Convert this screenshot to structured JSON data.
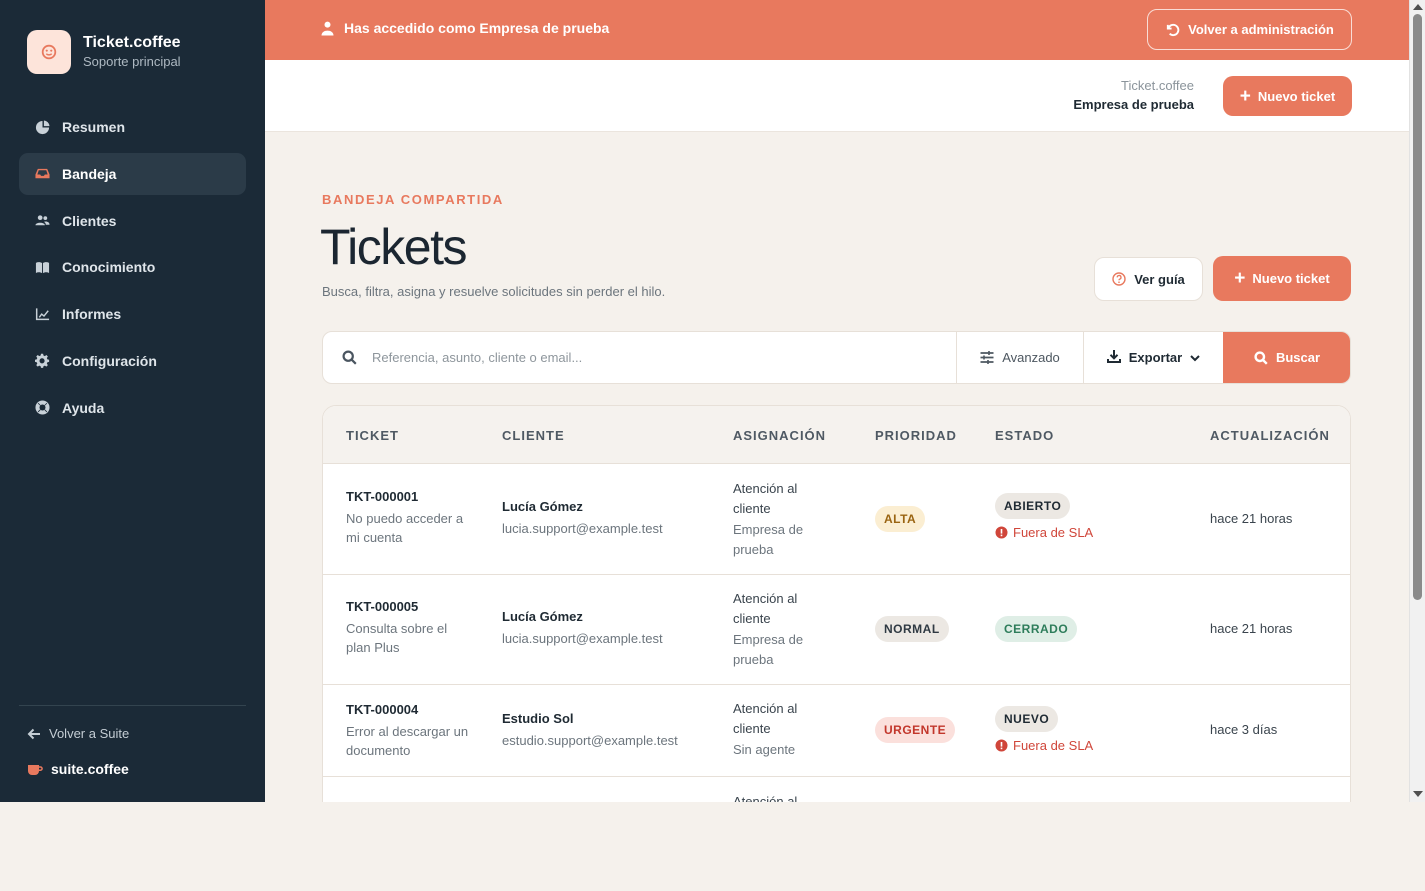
{
  "sidebar": {
    "brand_title": "Ticket.coffee",
    "brand_subtitle": "Soporte principal",
    "items": [
      {
        "label": "Resumen",
        "icon": "pie-chart-icon",
        "active": false
      },
      {
        "label": "Bandeja",
        "icon": "inbox-icon",
        "active": true
      },
      {
        "label": "Clientes",
        "icon": "users-icon",
        "active": false
      },
      {
        "label": "Conocimiento",
        "icon": "book-icon",
        "active": false
      },
      {
        "label": "Informes",
        "icon": "line-chart-icon",
        "active": false
      },
      {
        "label": "Configuración",
        "icon": "gear-icon",
        "active": false
      },
      {
        "label": "Ayuda",
        "icon": "lifebuoy-icon",
        "active": false
      }
    ],
    "back_label": "Volver a Suite",
    "suite_label": "suite.coffee"
  },
  "banner": {
    "message": "Has accedido como Empresa de prueba",
    "button": "Volver a administración"
  },
  "header": {
    "org_line1": "Ticket.coffee",
    "org_line2": "Empresa de prueba",
    "new_ticket": "Nuevo ticket"
  },
  "main": {
    "eyebrow": "BANDEJA COMPARTIDA",
    "title": "Tickets",
    "subtitle": "Busca, filtra, asigna y resuelve solicitudes sin perder el hilo.",
    "guide_button": "Ver guía",
    "new_ticket_button": "Nuevo ticket"
  },
  "search": {
    "placeholder": "Referencia, asunto, cliente o email...",
    "value": "",
    "advanced": "Avanzado",
    "export": "Exportar",
    "submit": "Buscar"
  },
  "table": {
    "headers": [
      "TICKET",
      "CLIENTE",
      "ASIGNACIÓN",
      "PRIORIDAD",
      "ESTADO",
      "ACTUALIZACIÓN"
    ],
    "rows": [
      {
        "id": "TKT-000001",
        "subject": "No puedo acceder a mi cuenta",
        "client_name": "Lucía Gómez",
        "client_email": "lucia.support@example.test",
        "team": "Atención al cliente",
        "agent": "Empresa de prueba",
        "priority": "ALTA",
        "status": "ABIERTO",
        "sla": "Fuera de SLA",
        "updated": "hace 21 horas"
      },
      {
        "id": "TKT-000005",
        "subject": "Consulta sobre el plan Plus",
        "client_name": "Lucía Gómez",
        "client_email": "lucia.support@example.test",
        "team": "Atención al cliente",
        "agent": "Empresa de prueba",
        "priority": "NORMAL",
        "status": "CERRADO",
        "sla": "",
        "updated": "hace 21 horas"
      },
      {
        "id": "TKT-000004",
        "subject": "Error al descargar un documento",
        "client_name": "Estudio Sol",
        "client_email": "estudio.support@example.test",
        "team": "Atención al cliente",
        "agent": "Sin agente",
        "priority": "URGENTE",
        "status": "NUEVO",
        "sla": "Fuera de SLA",
        "updated": "hace 3 días"
      },
      {
        "team": "Atención al"
      }
    ]
  },
  "colors": {
    "accent": "#e8795e",
    "sidebar_bg": "#1b2a37",
    "page_bg": "#f5f1ec",
    "danger": "#d0463a"
  }
}
